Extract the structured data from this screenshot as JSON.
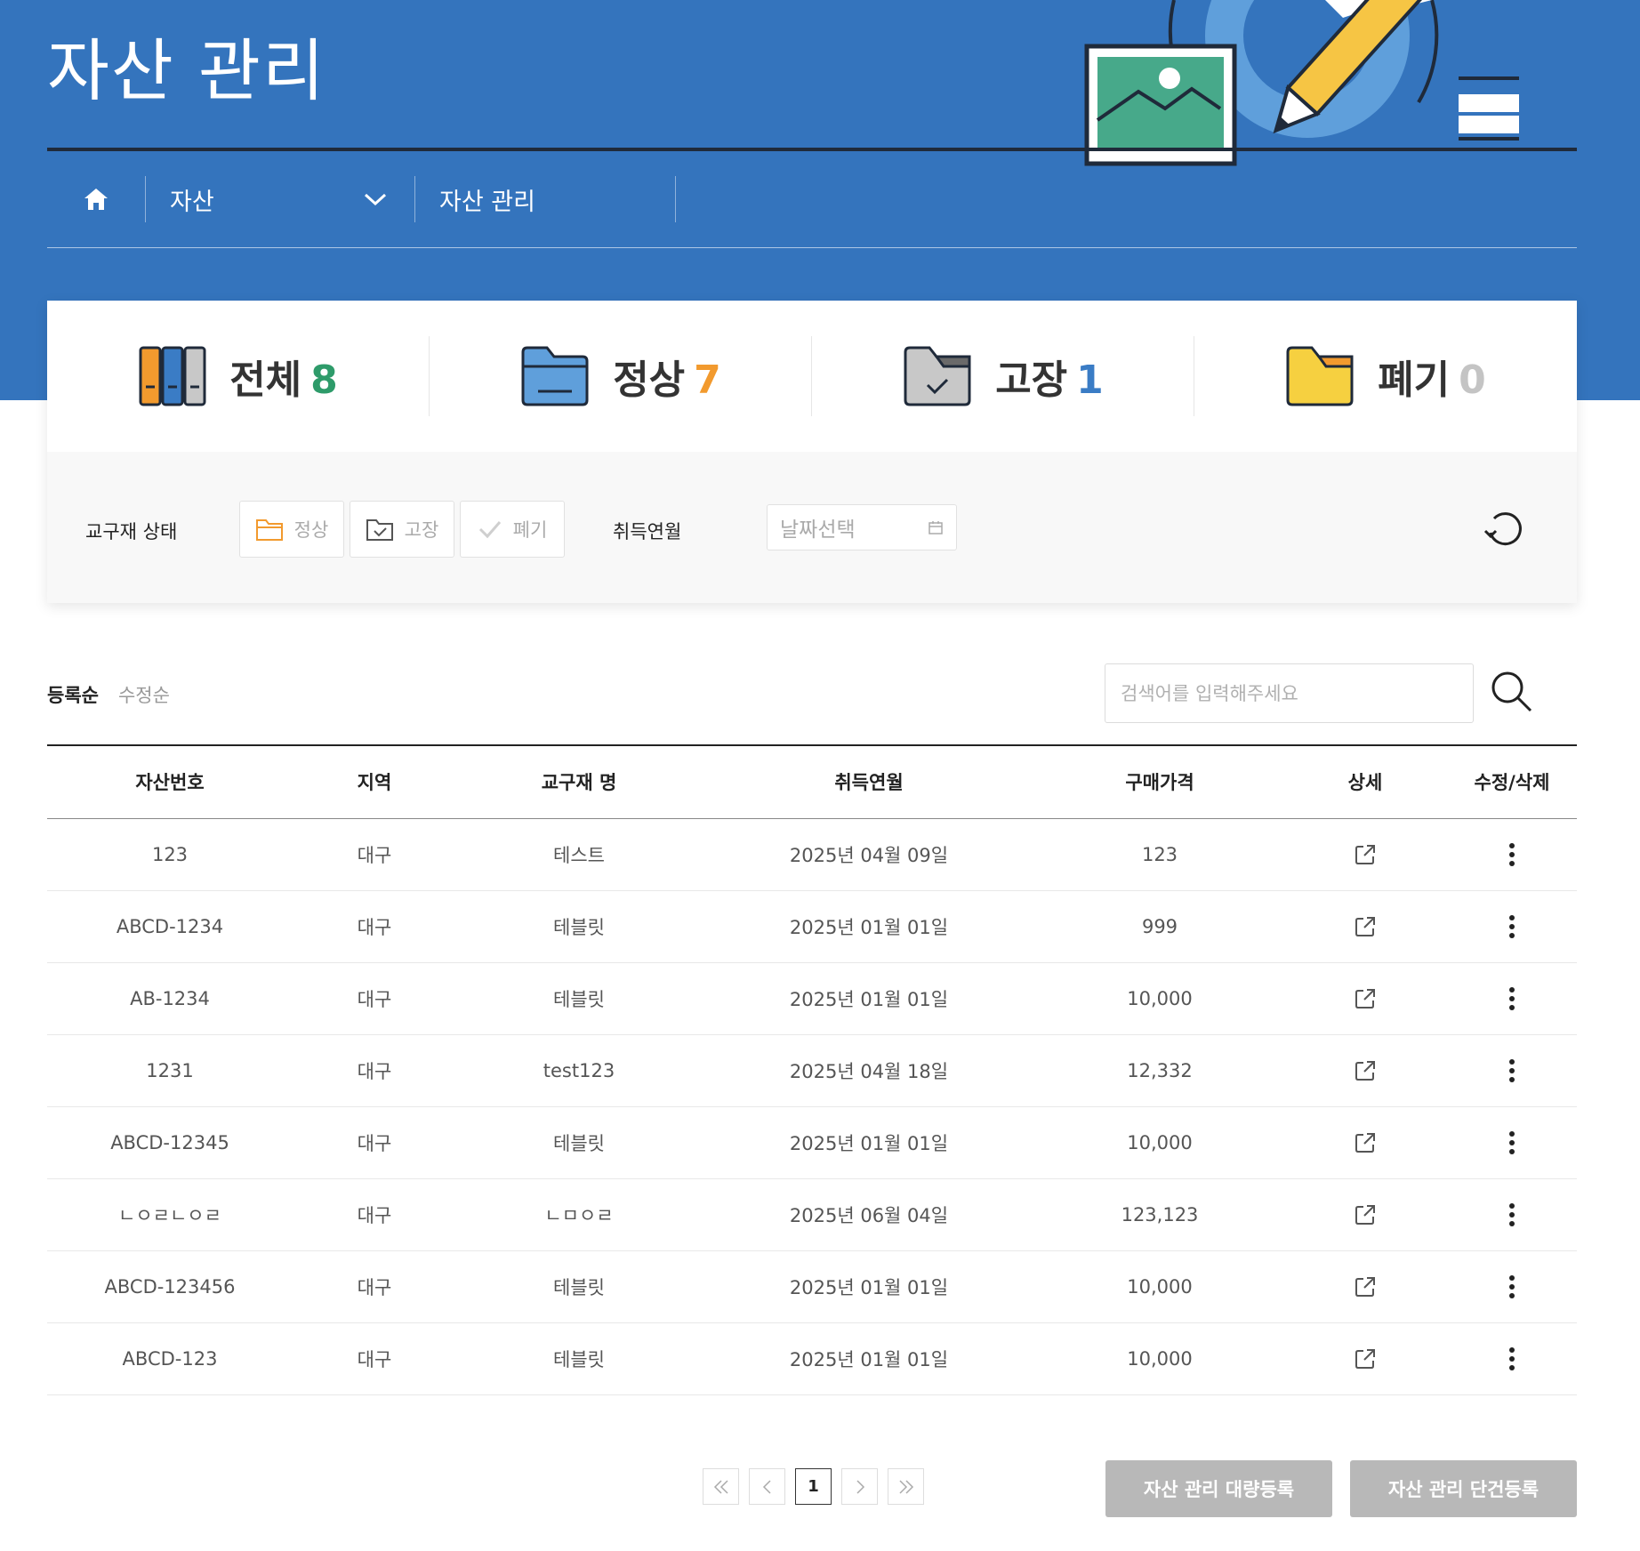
{
  "page": {
    "title": "자산 관리"
  },
  "breadcrumb": {
    "home_icon": "home-icon",
    "level1": "자산",
    "level2": "자산 관리"
  },
  "stats": [
    {
      "label": "전체",
      "count": "8",
      "color": "#2e9b6a",
      "icon": "books-icon"
    },
    {
      "label": "정상",
      "count": "7",
      "color": "#f29a2e",
      "icon": "folder-blue-icon"
    },
    {
      "label": "고장",
      "count": "1",
      "color": "#3a7cc5",
      "icon": "folder-check-icon"
    },
    {
      "label": "폐기",
      "count": "0",
      "color": "#c4c4c4",
      "icon": "folder-yellow-icon"
    }
  ],
  "filters": {
    "status_label": "교구재 상태",
    "status_buttons": [
      "정상",
      "고장",
      "폐기"
    ],
    "date_label": "취득연월",
    "date_placeholder": "날짜선택"
  },
  "sort": {
    "options": [
      "등록순",
      "수정순"
    ],
    "active": "등록순"
  },
  "search": {
    "placeholder": "검색어를 입력해주세요"
  },
  "table": {
    "headers": [
      "자산번호",
      "지역",
      "교구재 명",
      "취득연월",
      "구매가격",
      "상세",
      "수정/삭제"
    ],
    "rows": [
      [
        "123",
        "대구",
        "테스트",
        "2025년 04월 09일",
        "123"
      ],
      [
        "ABCD-1234",
        "대구",
        "테블릿",
        "2025년 01월 01일",
        "999"
      ],
      [
        "AB-1234",
        "대구",
        "테블릿",
        "2025년 01월 01일",
        "10,000"
      ],
      [
        "1231",
        "대구",
        "test123",
        "2025년 04월 18일",
        "12,332"
      ],
      [
        "ABCD-12345",
        "대구",
        "테블릿",
        "2025년 01월 01일",
        "10,000"
      ],
      [
        "ㄴㅇㄹㄴㅇㄹ",
        "대구",
        "ㄴㅁㅇㄹ",
        "2025년 06월 04일",
        "123,123"
      ],
      [
        "ABCD-123456",
        "대구",
        "테블릿",
        "2025년 01월 01일",
        "10,000"
      ],
      [
        "ABCD-123",
        "대구",
        "테블릿",
        "2025년 01월 01일",
        "10,000"
      ]
    ]
  },
  "pagination": {
    "current": "1"
  },
  "actions": {
    "bulk_register": "자산 관리 대량등록",
    "single_register": "자산 관리 단건등록"
  },
  "colors": {
    "hero": "#3474bd",
    "accent_green": "#47a98a",
    "accent_yellow": "#f6c544"
  }
}
